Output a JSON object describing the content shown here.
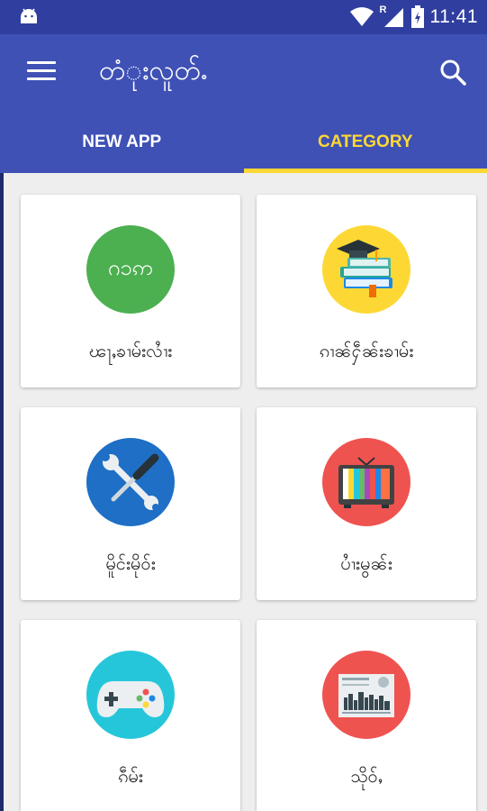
{
  "status_bar": {
    "time": "11:41",
    "signal_badge": "R",
    "icons": [
      "android-icon",
      "wifi-icon",
      "signal-icon",
      "battery-icon"
    ]
  },
  "app_bar": {
    "title": "တံုးလူတ်ႉ",
    "menu_icon": "hamburger-menu-icon",
    "search_icon": "search-icon"
  },
  "tabs": [
    {
      "label": "NEW APP",
      "active": false
    },
    {
      "label": "CATEGORY",
      "active": true
    }
  ],
  "colors": {
    "status_bar": "#303f9f",
    "app_bar": "#3f51b5",
    "active_tab": "#fdd835",
    "background": "#eeeeee"
  },
  "categories": [
    {
      "label": "ၽႃႇၶၢမ်းလၢႆး",
      "icon": "dictionary-icon",
      "icon_text": "ဂ၁ဢ",
      "color": "#4caf50"
    },
    {
      "label": "ၵၢၼ်ႁဵၼ်းၶၢမ်း",
      "icon": "education-icon",
      "color": "#fdd835"
    },
    {
      "label": "မိူင်းမိုဝ်း",
      "icon": "tools-icon",
      "color": "#1e6fc5"
    },
    {
      "label": "ပၢႆးမွၼ်း",
      "icon": "television-icon",
      "color": "#ef5350"
    },
    {
      "label": "ၵဵမ်း",
      "icon": "gamepad-icon",
      "color": "#26c6da"
    },
    {
      "label": "သိုဝ်ႇ",
      "icon": "newspaper-icon",
      "color": "#ef5350"
    }
  ]
}
